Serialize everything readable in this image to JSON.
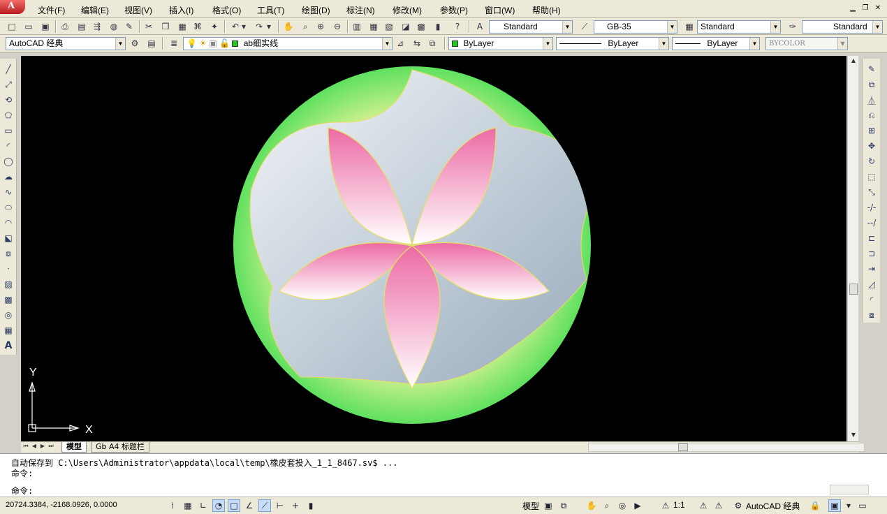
{
  "menubar": {
    "items": [
      "文件(F)",
      "编辑(E)",
      "视图(V)",
      "插入(I)",
      "格式(O)",
      "工具(T)",
      "绘图(D)",
      "标注(N)",
      "修改(M)",
      "参数(P)",
      "窗口(W)",
      "帮助(H)"
    ],
    "window_controls": [
      "▁",
      "❐",
      "✕"
    ]
  },
  "styles_toolbar": {
    "text_style": "Standard",
    "dim_style": "GB-35",
    "table_style": "Standard",
    "multileader_style": "Standard"
  },
  "workspace": {
    "name": "AutoCAD 经典",
    "layer": "ab细实线",
    "color": "ByLayer",
    "linetype": "ByLayer",
    "lineweight": "ByLayer",
    "plotstyle": "BYCOLOR"
  },
  "canvas": {
    "ucs_y": "Y",
    "ucs_x": "X",
    "colors": {
      "background": "#000000",
      "outer_green": "#5fe05f",
      "petal_pink": "#ec6aa4",
      "blue_gray": "#9fb2c0"
    }
  },
  "tabs": [
    "模型",
    "Gb A4 标题栏"
  ],
  "command": {
    "line1": "自动保存到 C:\\Users\\Administrator\\appdata\\local\\temp\\橡皮套投入_1_1_8467.sv$ ...",
    "line2": "命令:",
    "line3": "命令:"
  },
  "status": {
    "coordinates": "20724.3384, -2168.0926, 0.0000",
    "model_label": "模型",
    "annotation_scale": "1:1",
    "workspace_label": "AutoCAD 经典"
  }
}
